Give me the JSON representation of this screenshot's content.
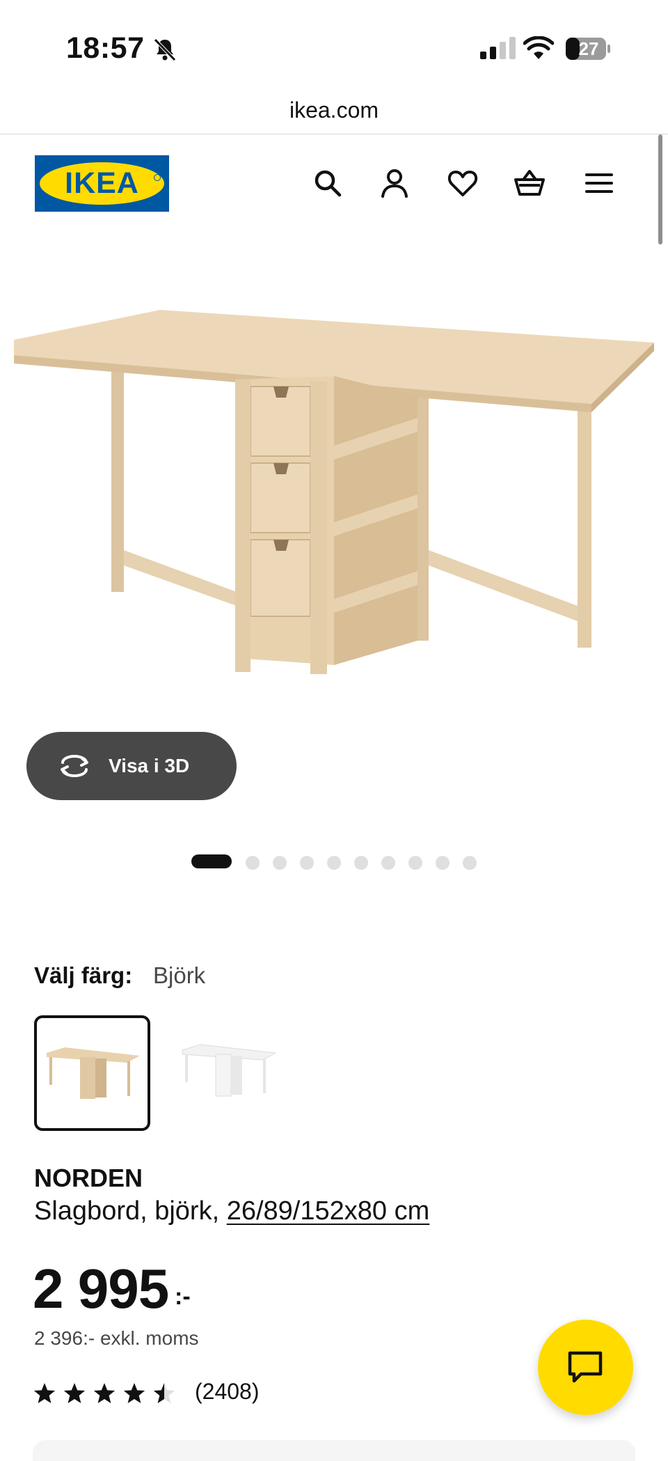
{
  "status_bar": {
    "time": "18:57",
    "battery": "27",
    "icons": [
      "bell-slash-icon",
      "signal-icon",
      "wifi-icon",
      "battery-icon"
    ]
  },
  "browser": {
    "url": "ikea.com"
  },
  "header": {
    "logo_text": "IKEA",
    "icons": [
      "search-icon",
      "account-icon",
      "heart-icon",
      "basket-icon",
      "menu-icon"
    ]
  },
  "gallery": {
    "view_3d_label": "Visa i 3D",
    "image_count": 10,
    "active_index": 0
  },
  "color_picker": {
    "label": "Välj färg:",
    "selected": "Björk"
  },
  "product": {
    "name": "NORDEN",
    "description_prefix": "Slagbord, björk, ",
    "dimensions": "26/89/152x80 cm",
    "price": "2 995",
    "price_suffix": ":-",
    "price_ex_vat": "2 396:- exkl. moms",
    "rating": 4.5,
    "review_count": "(2408)"
  },
  "colors": {
    "ikea_blue": "#0058a3",
    "ikea_yellow": "#ffdb00",
    "dark_gray": "#484848"
  }
}
